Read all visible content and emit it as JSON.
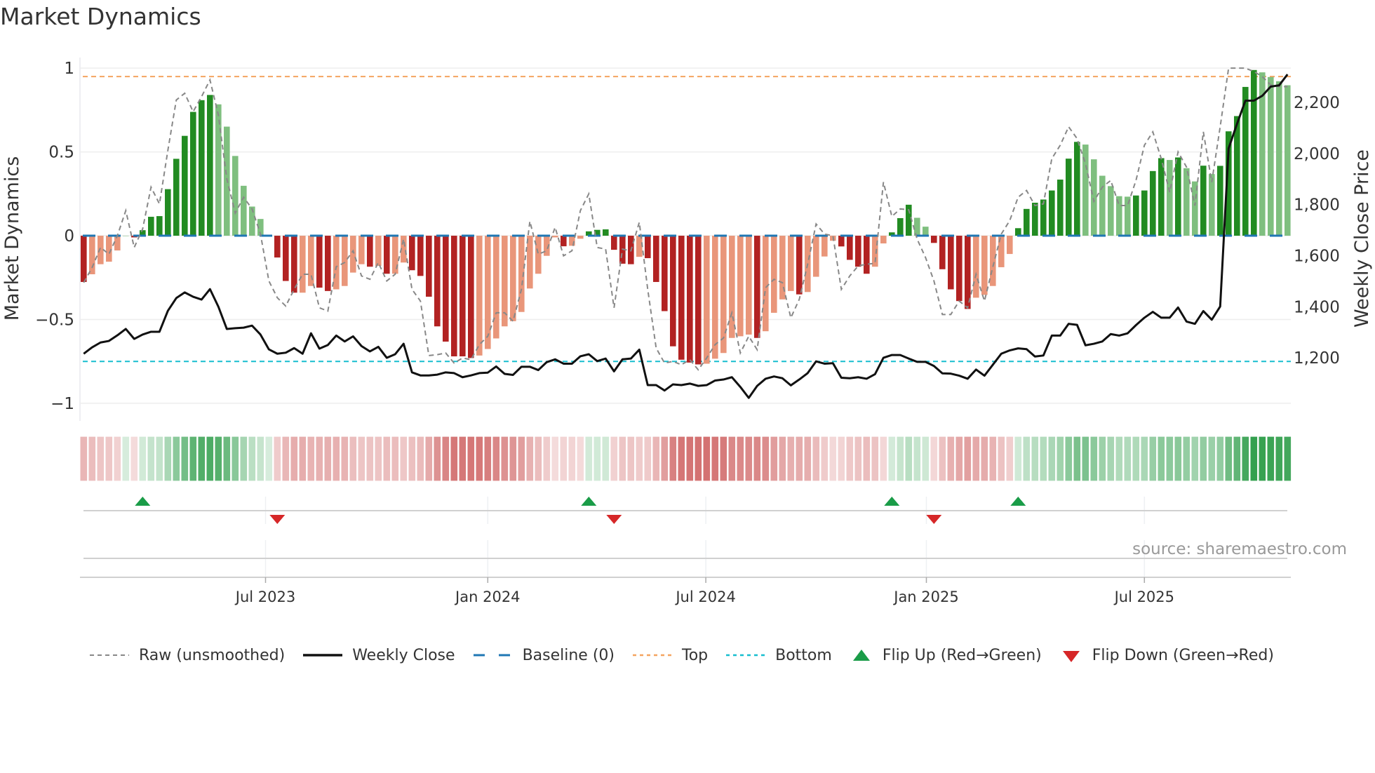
{
  "title": "Market Dynamics",
  "source": "source: sharemaestro.com",
  "chart_data": {
    "type": "bar",
    "title": "Market Dynamics",
    "ylabel": "Market Dynamics",
    "y2label": "Weekly Close Price",
    "ylim": [
      -1.105,
      1.03
    ],
    "y2lim": [
      953,
      2354
    ],
    "yticks": [
      {
        "v": 1,
        "label": "1"
      },
      {
        "v": 0.5,
        "label": "0.5"
      },
      {
        "v": 0,
        "label": "0"
      },
      {
        "v": -0.5,
        "label": "−0.5"
      },
      {
        "v": -1,
        "label": "−1"
      }
    ],
    "y2ticks": [
      {
        "v": 1200,
        "label": "1,200"
      },
      {
        "v": 1400,
        "label": "1,400"
      },
      {
        "v": 1600,
        "label": "1,600"
      },
      {
        "v": 1800,
        "label": "1,800"
      },
      {
        "v": 2000,
        "label": "2,000"
      },
      {
        "v": 2200,
        "label": "2,200"
      }
    ],
    "xticks": [
      {
        "week": 22.6,
        "label": "Jul 2023"
      },
      {
        "week": 49.0,
        "label": "Jan 2024"
      },
      {
        "week": 74.9,
        "label": "Jul 2024"
      },
      {
        "week": 101.1,
        "label": "Jan 2025"
      },
      {
        "week": 127.0,
        "label": "Jul 2025"
      }
    ],
    "top_level": 0.95,
    "bottom_level": -0.75,
    "baseline": 0,
    "dynamics": [
      -0.276,
      -0.23,
      -0.17,
      -0.155,
      -0.088,
      0,
      -0.01,
      0.033,
      0.113,
      0.117,
      0.278,
      0.459,
      0.596,
      0.739,
      0.809,
      0.84,
      0.784,
      0.651,
      0.476,
      0.298,
      0.174,
      0.1,
      0,
      -0.13,
      -0.27,
      -0.34,
      -0.34,
      -0.3,
      -0.31,
      -0.33,
      -0.32,
      -0.3,
      -0.22,
      -0.17,
      -0.185,
      -0.18,
      -0.227,
      -0.227,
      -0.16,
      -0.206,
      -0.24,
      -0.364,
      -0.541,
      -0.632,
      -0.72,
      -0.72,
      -0.73,
      -0.715,
      -0.676,
      -0.613,
      -0.541,
      -0.51,
      -0.455,
      -0.315,
      -0.227,
      -0.12,
      -0.01,
      -0.063,
      -0.06,
      -0.018,
      0.026,
      0.035,
      0.038,
      -0.084,
      -0.167,
      -0.17,
      -0.126,
      -0.134,
      -0.276,
      -0.45,
      -0.66,
      -0.74,
      -0.757,
      -0.768,
      -0.764,
      -0.734,
      -0.7,
      -0.61,
      -0.6,
      -0.59,
      -0.61,
      -0.57,
      -0.46,
      -0.38,
      -0.33,
      -0.35,
      -0.336,
      -0.245,
      -0.124,
      -0.03,
      -0.064,
      -0.144,
      -0.185,
      -0.227,
      -0.185,
      -0.046,
      0.02,
      0.105,
      0.185,
      0.107,
      0.054,
      -0.043,
      -0.2,
      -0.32,
      -0.39,
      -0.437,
      -0.37,
      -0.353,
      -0.3,
      -0.188,
      -0.109,
      0.045,
      0.16,
      0.197,
      0.216,
      0.27,
      0.335,
      0.46,
      0.56,
      0.544,
      0.456,
      0.358,
      0.296,
      0.236,
      0.233,
      0.24,
      0.27,
      0.386,
      0.463,
      0.452,
      0.467,
      0.403,
      0.324,
      0.418,
      0.368,
      0.417,
      0.623,
      0.714,
      0.888,
      0.989,
      0.975,
      0.947,
      0.922,
      0.898
    ],
    "strengthening": [
      1,
      0,
      0,
      0,
      0,
      0,
      1,
      1,
      1,
      1,
      1,
      1,
      1,
      1,
      1,
      1,
      0,
      0,
      0,
      0,
      0,
      0,
      0,
      1,
      1,
      1,
      0,
      0,
      1,
      1,
      0,
      0,
      0,
      0,
      1,
      0,
      1,
      0,
      0,
      1,
      1,
      1,
      1,
      1,
      1,
      1,
      1,
      0,
      0,
      0,
      0,
      0,
      0,
      0,
      0,
      0,
      0,
      1,
      0,
      0,
      1,
      1,
      1,
      1,
      1,
      1,
      0,
      1,
      1,
      1,
      1,
      1,
      1,
      1,
      0,
      0,
      0,
      0,
      0,
      0,
      1,
      0,
      0,
      0,
      0,
      1,
      0,
      0,
      0,
      0,
      1,
      1,
      1,
      1,
      0,
      0,
      1,
      1,
      1,
      0,
      0,
      1,
      1,
      1,
      1,
      1,
      0,
      0,
      0,
      0,
      0,
      1,
      1,
      1,
      1,
      1,
      1,
      1,
      1,
      0,
      0,
      0,
      0,
      0,
      0,
      1,
      1,
      1,
      1,
      0,
      1,
      0,
      0,
      1,
      0,
      1,
      1,
      1,
      1,
      1,
      0,
      0,
      0,
      0
    ],
    "raw": [
      -0.28,
      -0.19,
      -0.07,
      -0.11,
      0,
      0.15,
      -0.07,
      0.04,
      0.29,
      0.19,
      0.51,
      0.81,
      0.85,
      0.74,
      0.83,
      0.93,
      0.72,
      0.34,
      0.135,
      0.23,
      0.16,
      0.01,
      -0.27,
      -0.37,
      -0.42,
      -0.32,
      -0.23,
      -0.23,
      -0.43,
      -0.45,
      -0.185,
      -0.16,
      -0.09,
      -0.24,
      -0.26,
      -0.16,
      -0.27,
      -0.23,
      -0.02,
      -0.32,
      -0.39,
      -0.715,
      -0.71,
      -0.7,
      -0.76,
      -0.73,
      -0.74,
      -0.65,
      -0.6,
      -0.46,
      -0.46,
      -0.51,
      -0.32,
      0.086,
      -0.11,
      -0.09,
      0.05,
      -0.12,
      -0.09,
      0.15,
      0.25,
      -0.07,
      -0.08,
      -0.43,
      -0.08,
      -0.09,
      0.08,
      -0.32,
      -0.67,
      -0.76,
      -0.75,
      -0.77,
      -0.74,
      -0.8,
      -0.73,
      -0.65,
      -0.61,
      -0.46,
      -0.7,
      -0.6,
      -0.68,
      -0.31,
      -0.26,
      -0.28,
      -0.49,
      -0.38,
      -0.17,
      0.07,
      0.01,
      0.0,
      -0.32,
      -0.24,
      -0.18,
      -0.17,
      -0.165,
      0.32,
      0.115,
      0.16,
      0.155,
      -0.02,
      -0.13,
      -0.27,
      -0.47,
      -0.47,
      -0.39,
      -0.43,
      -0.23,
      -0.39,
      -0.185,
      0.01,
      0.09,
      0.23,
      0.27,
      0.18,
      0.19,
      0.46,
      0.54,
      0.65,
      0.58,
      0.43,
      0.205,
      0.29,
      0.33,
      0.18,
      0.18,
      0.33,
      0.54,
      0.62,
      0.46,
      0.26,
      0.5,
      0.41,
      0.18,
      0.62,
      0.32,
      0.65,
      1.0,
      1.0,
      1.0,
      0.98,
      0.95,
      0.9,
      0.89,
      0.89
    ],
    "close": [
      1216,
      1241,
      1260,
      1266,
      1288,
      1313,
      1274,
      1291,
      1302,
      1302,
      1384,
      1434,
      1456,
      1439,
      1428,
      1469,
      1400,
      1313,
      1316,
      1318,
      1326,
      1291,
      1233,
      1216,
      1220,
      1238,
      1216,
      1296,
      1236,
      1250,
      1287,
      1264,
      1284,
      1246,
      1225,
      1243,
      1200,
      1214,
      1255,
      1143,
      1131,
      1131,
      1134,
      1143,
      1140,
      1124,
      1131,
      1140,
      1142,
      1166,
      1137,
      1133,
      1165,
      1165,
      1152,
      1183,
      1194,
      1177,
      1177,
      1206,
      1214,
      1187,
      1197,
      1147,
      1194,
      1197,
      1232,
      1093,
      1093,
      1072,
      1096,
      1093,
      1099,
      1090,
      1093,
      1111,
      1115,
      1124,
      1086,
      1043,
      1090,
      1118,
      1127,
      1120,
      1092,
      1115,
      1140,
      1186,
      1177,
      1179,
      1122,
      1120,
      1124,
      1118,
      1136,
      1200,
      1211,
      1211,
      1197,
      1184,
      1184,
      1168,
      1139,
      1138,
      1130,
      1118,
      1154,
      1130,
      1173,
      1216,
      1229,
      1237,
      1234,
      1205,
      1209,
      1287,
      1287,
      1333,
      1329,
      1249,
      1255,
      1264,
      1293,
      1287,
      1296,
      1328,
      1357,
      1380,
      1357,
      1357,
      1397,
      1342,
      1333,
      1383,
      1349,
      1401,
      2020,
      2116,
      2207,
      2207,
      2226,
      2262,
      2267,
      2310
    ],
    "flips_up_week": [
      8,
      61,
      97,
      112
    ],
    "flips_down_week": [
      24,
      64,
      102
    ],
    "legend": {
      "placement": "bottom",
      "items": [
        {
          "label": "Raw (unsmoothed)",
          "kind": "dashed-grey"
        },
        {
          "label": "Weekly Close",
          "kind": "solid-black"
        },
        {
          "label": "Baseline (0)",
          "kind": "dashed-blue"
        },
        {
          "label": "Top",
          "kind": "dotted-orange"
        },
        {
          "label": "Bottom",
          "kind": "dotted-cyan"
        },
        {
          "label": "Flip Up (Red→Green)",
          "kind": "triangle-up-green"
        },
        {
          "label": "Flip Down (Green→Red)",
          "kind": "triangle-down-red"
        }
      ]
    }
  },
  "colors": {
    "strong_green": "#228b22",
    "weak_green": "#7fbf7f",
    "strong_red": "#b22222",
    "weak_red": "#e9967a",
    "raw": "#888888",
    "close": "#111111",
    "baseline": "#1f77b4",
    "top": "#f4a460",
    "bottom": "#17becf",
    "flip_up": "#1a9c48",
    "flip_down": "#d62728"
  }
}
